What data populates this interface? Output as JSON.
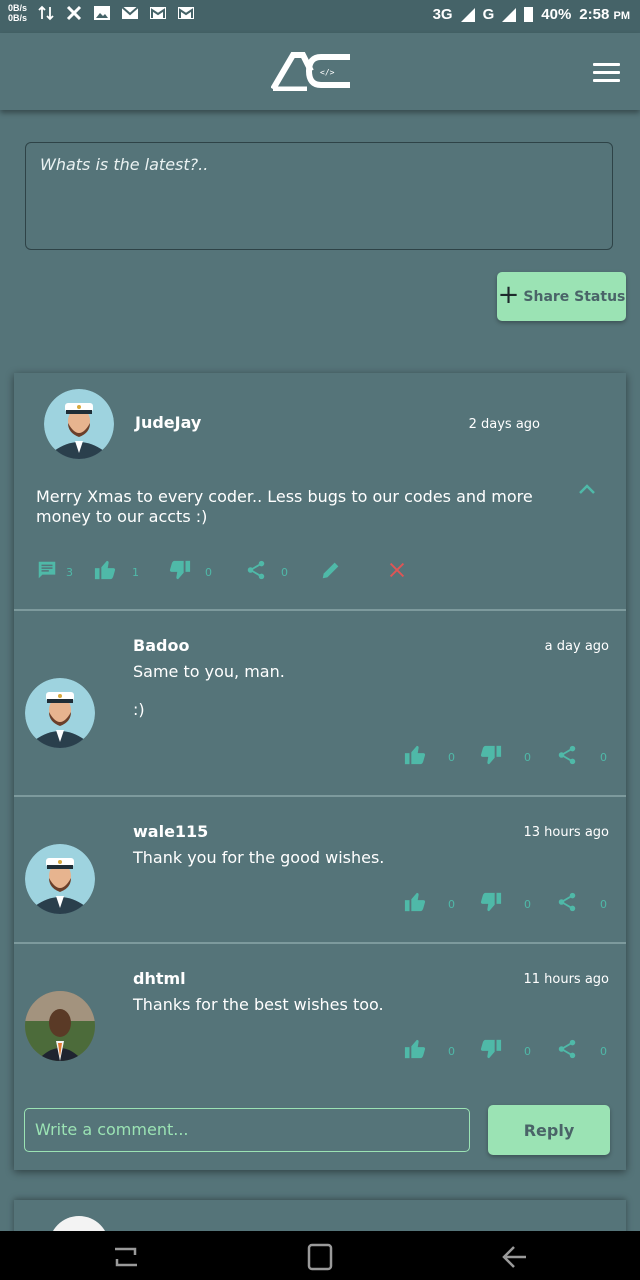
{
  "status_bar": {
    "net_up": "0B/s",
    "net_down": "0B/s",
    "network_3g": "3G",
    "network_g": "G",
    "battery": "40%",
    "time": "2:58",
    "ampm": "PM"
  },
  "header": {
    "logo_icon": "ac-code-logo",
    "menu_icon": "hamburger-menu-icon"
  },
  "composer": {
    "placeholder": "Whats is the latest?..",
    "share_label": "Share Status"
  },
  "post": {
    "author": "JudeJay",
    "time": "2 days ago",
    "text": "Merry Xmas to every coder.. Less bugs to our codes and more money to our accts :)",
    "comments_count": "3",
    "likes": "1",
    "dislikes": "0",
    "shares": "0"
  },
  "comments": [
    {
      "author": "Badoo",
      "time": "a day ago",
      "text": "Same to you, man.",
      "text2": ":)",
      "likes": "0",
      "dislikes": "0",
      "shares": "0"
    },
    {
      "author": "wale115",
      "time": "13 hours ago",
      "text": "Thank you for the good wishes.",
      "likes": "0",
      "dislikes": "0",
      "shares": "0"
    },
    {
      "author": "dhtml",
      "time": "11 hours ago",
      "text": "Thanks for the best wishes too.",
      "likes": "0",
      "dislikes": "0",
      "shares": "0"
    }
  ],
  "comment_box": {
    "placeholder": "Write a comment...",
    "reply_label": "Reply"
  },
  "colors": {
    "background": "#557479",
    "accent": "#9be3b4",
    "icon_teal": "#4fb9a8",
    "delete_red": "#e05555"
  }
}
